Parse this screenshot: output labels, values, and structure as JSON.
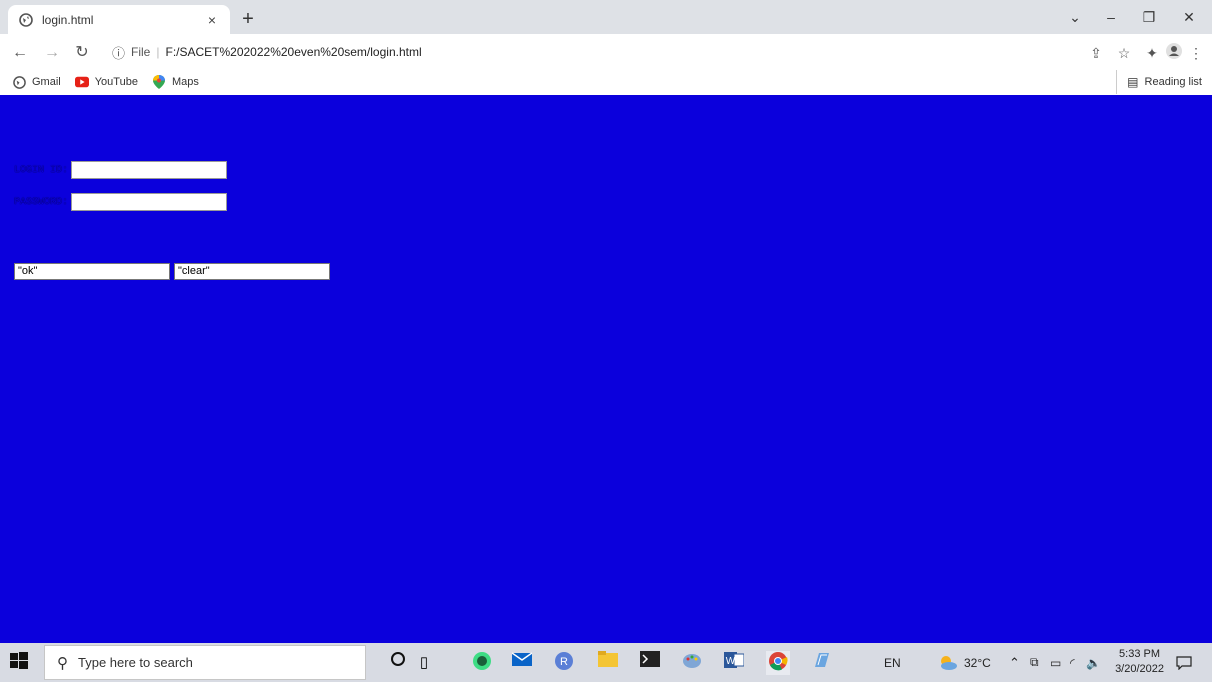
{
  "browser": {
    "tab_title": "login.html",
    "tab_close": "×",
    "new_tab": "+",
    "window": {
      "minimize": "–",
      "restore": "❐",
      "close": "✕",
      "dropdown": "⌄"
    },
    "address": {
      "scheme": "File",
      "separator": "|",
      "url": "F:/SACET%202022%20even%20sem/login.html"
    },
    "bookmarks": [
      {
        "label": "Gmail",
        "icon": "globe-icon"
      },
      {
        "label": "YouTube",
        "icon": "youtube-icon"
      },
      {
        "label": "Maps",
        "icon": "maps-icon"
      }
    ],
    "reading_list": "Reading list"
  },
  "page": {
    "background": "#0b00dc",
    "login_label": "LOGIN ID:",
    "password_label": "PASSWORD:",
    "ok_value": "\"ok\"",
    "clear_value": "\"clear\""
  },
  "taskbar": {
    "search_placeholder": "Type here to search",
    "language": "EN",
    "temperature": "32°C",
    "time": "5:33 PM",
    "date": "3/20/2022"
  }
}
